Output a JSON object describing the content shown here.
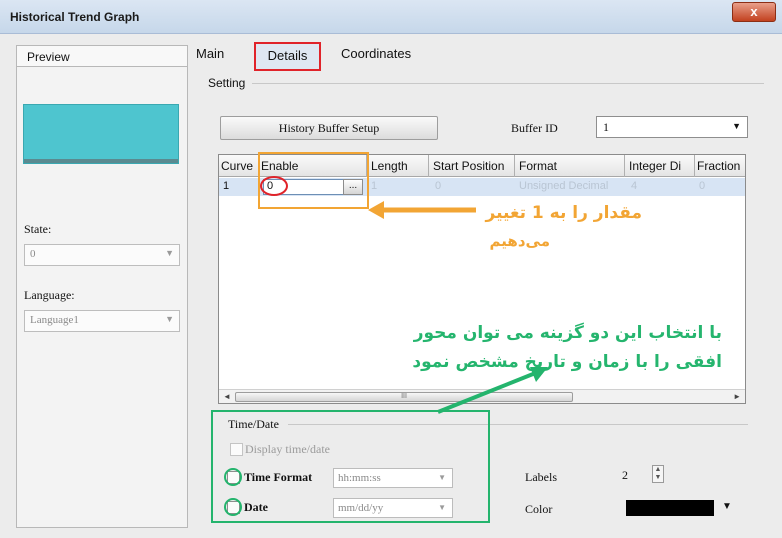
{
  "window": {
    "title": "Historical Trend Graph",
    "close_symbol": "x"
  },
  "sidebar": {
    "preview_tab": "Preview",
    "state_label": "State:",
    "state_value": "0",
    "language_label": "Language:",
    "language_value": "Language1"
  },
  "tabs": {
    "main": "Main",
    "details": "Details",
    "coordinates": "Coordinates"
  },
  "setting": {
    "label": "Setting",
    "history_button": "History Buffer Setup",
    "buffer_id_label": "Buffer ID",
    "buffer_id_value": "1"
  },
  "table": {
    "columns": [
      "Curve",
      "Enable",
      "Length",
      "Start Position",
      "Format",
      "Integer Di",
      "Fraction"
    ],
    "row": {
      "curve": "1",
      "enable_value": "0",
      "dots": "...",
      "length": "1",
      "start_position": "0",
      "format": "Unsigned Decimal",
      "integer": "4",
      "fraction": "0"
    },
    "scroll_grip": "III"
  },
  "time_date": {
    "label": "Time/Date",
    "display_label": "Display time/date",
    "time_format_label": "Time Format",
    "time_format_value": "hh:mm:ss",
    "date_label": "Date",
    "date_value": "mm/dd/yy",
    "labels_label": "Labels",
    "labels_value": "2",
    "color_label": "Color",
    "color_value": "#000000"
  },
  "annotations": {
    "orange_line1": "مقدار را به 1 تغییر",
    "orange_line2": "می‌دهیم",
    "green_line1": "با انتخاب این دو گزینه می توان محور",
    "green_line2": "افقی را با زمان و تاریخ مشخص نمود",
    "orange_color": "#f2a534",
    "green_color": "#24b46d",
    "red_color": "#e0232a"
  }
}
